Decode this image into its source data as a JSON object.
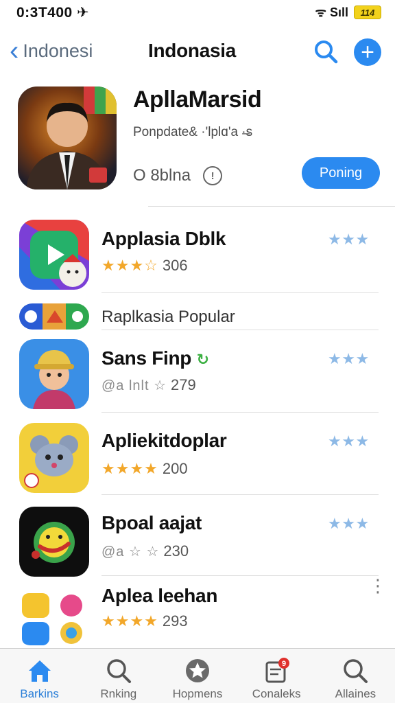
{
  "status_bar": {
    "time": "0:3T400 ✈",
    "signal": "ᯤ Sıll",
    "battery": "114"
  },
  "nav": {
    "back_label": "Indonesi",
    "title": "Indonasia"
  },
  "featured": {
    "title": "ApllaMarsid",
    "subtitle": "Ponpdate& ·'lplɑ'a ·̶s",
    "meta": "O 8blna",
    "info_glyph": "!",
    "button_label": "Poning"
  },
  "apps": [
    {
      "name": "Applasia Dblk",
      "stars": "★★★☆",
      "rating": "306",
      "trail": "★★★",
      "stars_style": "gold"
    },
    {
      "name": "Sans Finp",
      "stars": "@a lnlt ☆",
      "rating": "279",
      "trail": "★★★",
      "stars_style": "light"
    },
    {
      "name": "Apliekitdoplar",
      "stars": "★★★★",
      "rating": "200",
      "trail": "★★★",
      "stars_style": "gold"
    },
    {
      "name": "Bpoal aajat",
      "stars": "@a ☆ ☆",
      "rating": "230",
      "trail": "★★★",
      "stars_style": "light"
    },
    {
      "name": "Aplea leehan",
      "stars": "★★★★",
      "rating": "293",
      "trail": "",
      "stars_style": "gold"
    }
  ],
  "section": {
    "title": "Raplkasia Popular"
  },
  "tabs": [
    {
      "label": "Barkins",
      "icon": "home-icon",
      "active": true
    },
    {
      "label": "Rnking",
      "icon": "search-icon",
      "active": false
    },
    {
      "label": "Hopmens",
      "icon": "star-icon",
      "active": false
    },
    {
      "label": "Conaleks",
      "icon": "updates-icon",
      "active": false,
      "badge": "9"
    },
    {
      "label": "Allaines",
      "icon": "search-icon",
      "active": false
    }
  ],
  "colors": {
    "accent": "#2b8af0",
    "star": "#f2a72a",
    "trail_star": "#8db9e6"
  }
}
